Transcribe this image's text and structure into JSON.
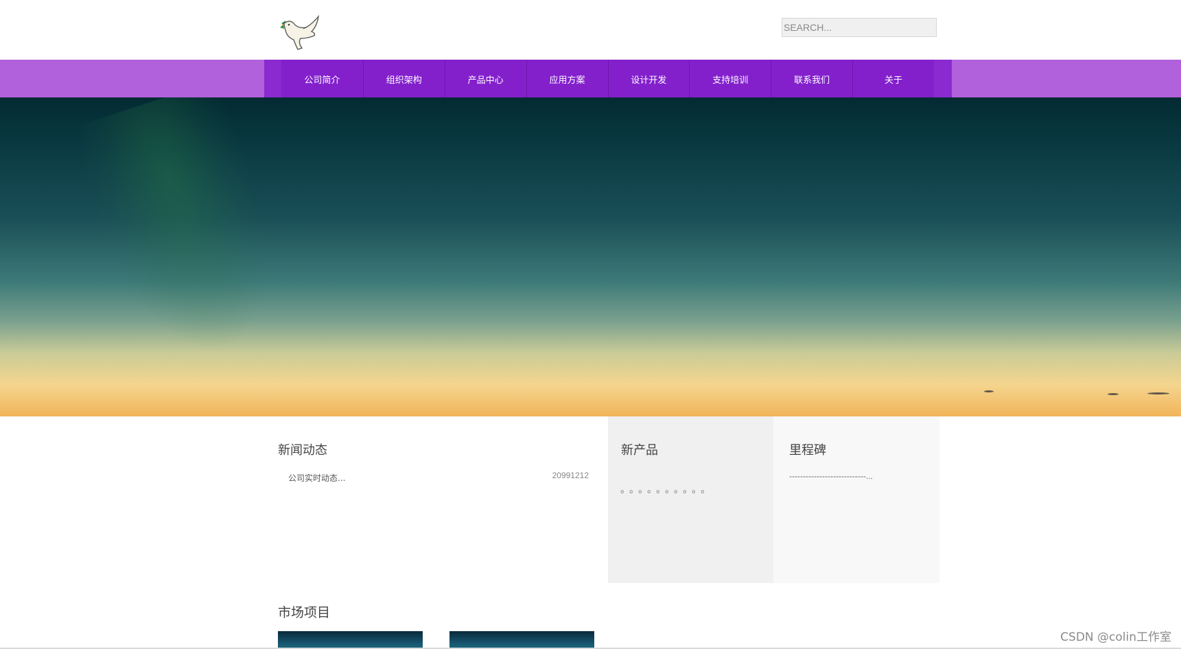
{
  "search": {
    "placeholder": "SEARCH..."
  },
  "nav": {
    "items": [
      {
        "label": "公司简介"
      },
      {
        "label": "组织架构"
      },
      {
        "label": "产品中心"
      },
      {
        "label": "应用方案"
      },
      {
        "label": "设计开发"
      },
      {
        "label": "支持培训"
      },
      {
        "label": "联系我们"
      },
      {
        "label": "关于"
      }
    ]
  },
  "news": {
    "title": "新闻动态",
    "items": [
      {
        "title": "公司实时动态...",
        "date": "20991212"
      }
    ]
  },
  "products": {
    "title": "新产品",
    "content": "。。。。。。。。。。"
  },
  "milestones": {
    "title": "里程碑",
    "content": "----------------------------..."
  },
  "market": {
    "title": "市场项目"
  },
  "watermark": "CSDN @colin工作室",
  "colors": {
    "nav_band": "#b161db",
    "nav_menu": "#8320cc",
    "products_bg": "#f0f0f0",
    "milestones_bg": "#f8f8f8"
  },
  "icons": {
    "logo": "dove-with-olive-branch-icon"
  }
}
